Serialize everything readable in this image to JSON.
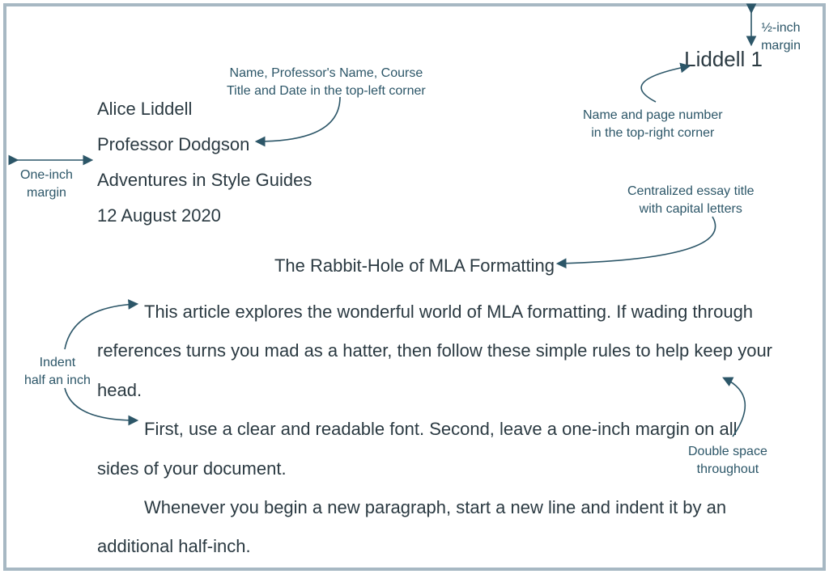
{
  "annotations": {
    "top_margin": "½-inch\nmargin",
    "header_info": "Name, Professor's Name, Course\nTitle and Date in the top-left corner",
    "header_page": "Name and page number\nin the top-right corner",
    "left_margin": "One-inch\nmargin",
    "title_note": "Centralized essay title\nwith capital letters",
    "indent_note": "Indent\nhalf an inch",
    "double_space": "Double space\nthroughout"
  },
  "header": {
    "running_head": "Liddell 1"
  },
  "info": {
    "name": "Alice Liddell",
    "professor": "Professor Dodgson",
    "course": "Adventures in Style Guides",
    "date": "12 August 2020"
  },
  "title": "The Rabbit-Hole of MLA Formatting",
  "paragraphs": {
    "p1": "This article explores the wonderful world of MLA formatting. If wading through references turns you mad as a hatter, then follow these simple rules to help keep your head.",
    "p2": "First, use a clear and readable font. Second, leave a one-inch margin on all sides of your document.",
    "p3": "Whenever you begin a new paragraph, start a new line and indent it by an additional half-inch."
  }
}
